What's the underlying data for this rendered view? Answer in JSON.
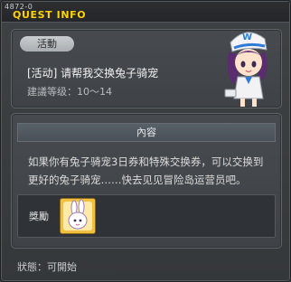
{
  "window": {
    "quest_id": "4872-0",
    "title": "QUEST INFO"
  },
  "quest": {
    "category_tag": "活動",
    "name": "[活动] 请帮我交换兔子骑宠",
    "level_text": "建議等级：10～14",
    "npc_icon": "npc-girl-portrait-icon"
  },
  "content": {
    "header": "內容",
    "description": "如果你有兔子骑宠3日券和特殊交换券，可以交换到更好的兔子骑宠……快去见见冒险岛运营员吧。"
  },
  "reward": {
    "label": "獎勵",
    "item_icon": "rabbit-mount-voucher-icon"
  },
  "status": {
    "text": "狀態：可開始"
  },
  "colors": {
    "title": "#ffd200",
    "background": "#3a3d40",
    "panel": "#43474b"
  }
}
